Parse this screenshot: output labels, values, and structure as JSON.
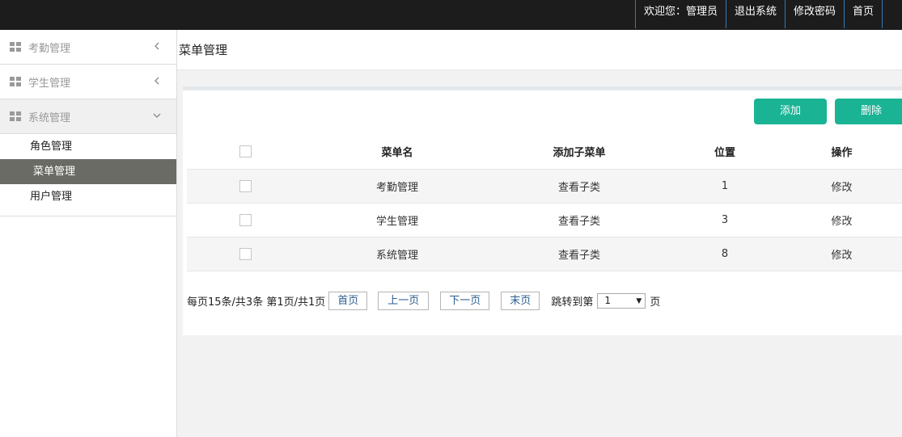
{
  "topnav": {
    "welcome": "欢迎您：管理员",
    "logout": "退出系统",
    "change_password": "修改密码",
    "home": "首页"
  },
  "sidebar": {
    "groups": [
      {
        "label": "考勤管理",
        "state": "collapsed"
      },
      {
        "label": "学生管理",
        "state": "collapsed"
      },
      {
        "label": "系统管理",
        "state": "expanded"
      }
    ],
    "sub_items": [
      {
        "label": "角色管理"
      },
      {
        "label": "菜单管理",
        "active": true
      },
      {
        "label": "用户管理"
      }
    ]
  },
  "page_title": "菜单管理",
  "toolbar": {
    "add_label": "添加",
    "delete_label": "删除",
    "accent_color": "#1ab394"
  },
  "table": {
    "headers": [
      "菜单名",
      "添加子菜单",
      "位置",
      "操作"
    ],
    "rows": [
      {
        "name": "考勤管理",
        "sub": "查看子类",
        "position": "1",
        "action": "修改"
      },
      {
        "name": "学生管理",
        "sub": "查看子类",
        "position": "3",
        "action": "修改"
      },
      {
        "name": "系统管理",
        "sub": "查看子类",
        "position": "8",
        "action": "修改"
      }
    ]
  },
  "pager": {
    "summary": "每页15条/共3条 第1页/共1页",
    "first": "首页",
    "prev": "上一页",
    "next": "下一页",
    "last": "末页",
    "jump_label": "跳转到第",
    "jump_value": "1",
    "page_suffix": "页"
  }
}
